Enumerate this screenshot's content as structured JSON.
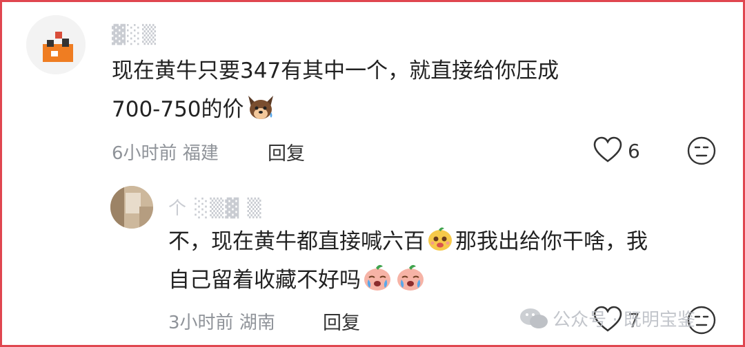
{
  "comment1": {
    "author": "▓░▒",
    "text_line1": "现在黄牛只要347有其中一个，就直接给你压成",
    "text_line2": "700-750的价",
    "emoji_names": [
      "dog-sweat-emoji"
    ],
    "time": "6小时前",
    "location": "福建",
    "reply_label": "回复",
    "likes": "6"
  },
  "comment2": {
    "author": "个 ░▒▓ ▒",
    "text_line1_a": "不，现在黄牛都直接喊六百",
    "text_line1_b": "那我出给你干啥，我",
    "text_line2": "自己留着收藏不好吗",
    "emoji_names": [
      "yellow-smile-emoji",
      "crying-peach-emoji",
      "crying-peach-emoji"
    ],
    "time": "3小时前",
    "location": "湖南",
    "reply_label": "回复",
    "likes": "7"
  },
  "watermark": {
    "text": "公众号 · 既明宝鉴"
  },
  "colors": {
    "border": "#e0464f",
    "text": "#222222",
    "meta": "#8f9399"
  }
}
